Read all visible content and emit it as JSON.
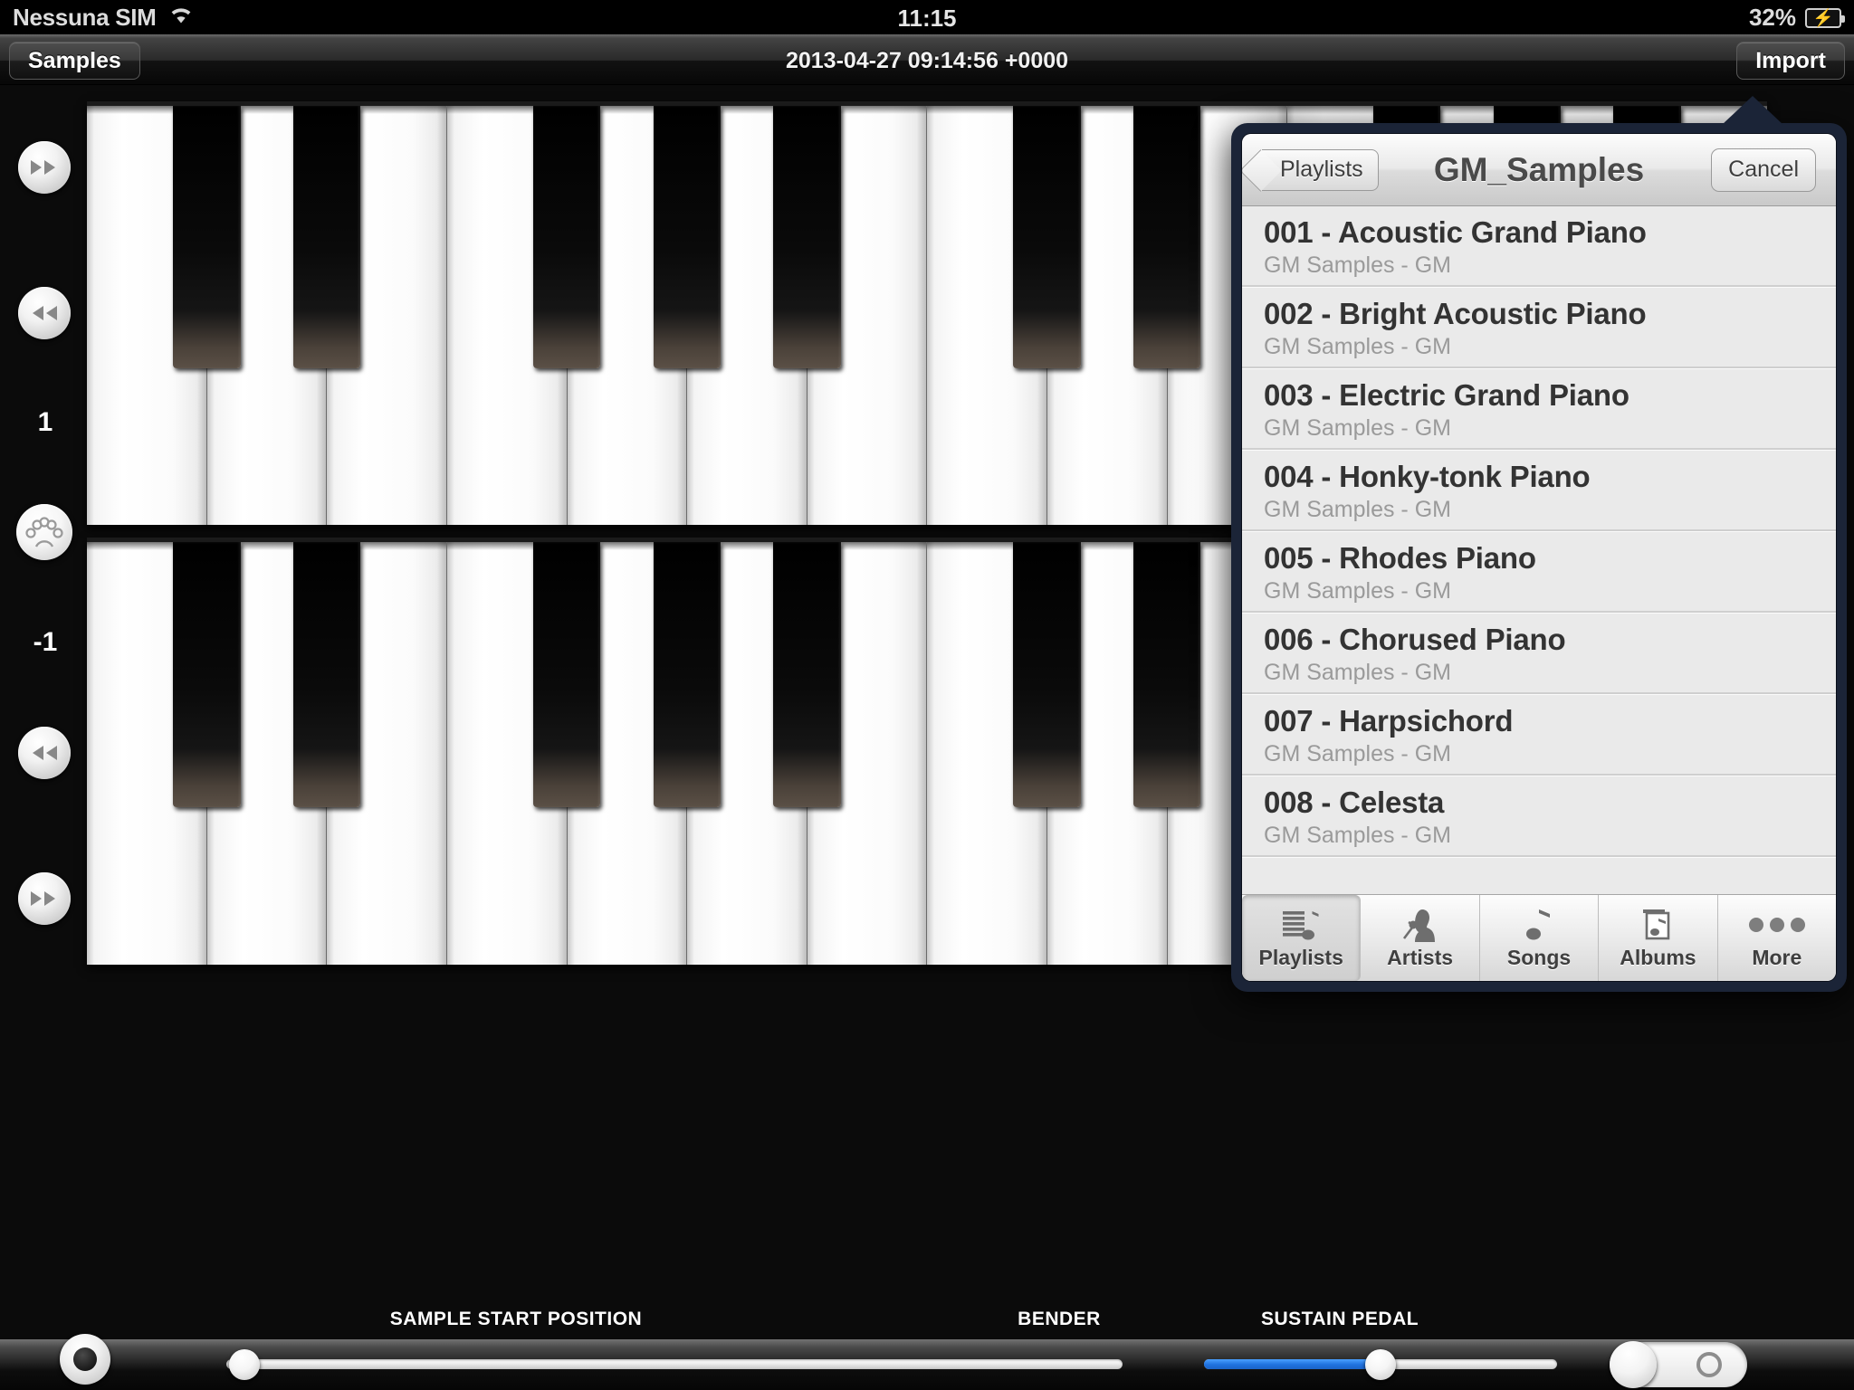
{
  "status_bar": {
    "carrier": "Nessuna SIM",
    "wifi_icon": "wifi-icon",
    "time": "11:15",
    "battery_percent": "32%",
    "battery_icon": "battery-charging-icon"
  },
  "navbar": {
    "back_label": "Samples",
    "title": "2013-04-27 09:14:56 +0000",
    "import_label": "Import"
  },
  "side_controls": {
    "upper_octave_up": "fast-forward-icon",
    "upper_octave_down": "rewind-icon",
    "upper_transpose_value": "1",
    "midi_icon": "midi-din-icon",
    "lower_transpose_value": "-1",
    "lower_octave_down": "rewind-icon",
    "lower_octave_up": "fast-forward-icon",
    "right_upper": "fast-forward-icon",
    "right_lower": "rewind-icon"
  },
  "bottom": {
    "sample_start_label": "SAMPLE START POSITION",
    "bender_label": "BENDER",
    "sustain_label": "SUSTAIN PEDAL",
    "sample_start_value": 2,
    "bender_value": 50,
    "sustain_on": false,
    "accent_color": "#1f72e0"
  },
  "popover": {
    "back_label": "Playlists",
    "title": "GM_Samples",
    "cancel_label": "Cancel",
    "rows": [
      {
        "title": "001 - Acoustic Grand Piano",
        "subtitle": "GM Samples - GM"
      },
      {
        "title": "002 - Bright Acoustic Piano",
        "subtitle": "GM Samples - GM"
      },
      {
        "title": "003 - Electric Grand Piano",
        "subtitle": "GM Samples - GM"
      },
      {
        "title": "004 - Honky-tonk Piano",
        "subtitle": "GM Samples - GM"
      },
      {
        "title": "005 - Rhodes Piano",
        "subtitle": "GM Samples - GM"
      },
      {
        "title": "006 - Chorused Piano",
        "subtitle": "GM Samples - GM"
      },
      {
        "title": "007 - Harpsichord",
        "subtitle": "GM Samples - GM"
      },
      {
        "title": "008 - Celesta",
        "subtitle": "GM Samples - GM"
      }
    ],
    "tabs": [
      {
        "label": "Playlists",
        "icon": "playlist-note-icon",
        "selected": true
      },
      {
        "label": "Artists",
        "icon": "artist-mic-icon",
        "selected": false
      },
      {
        "label": "Songs",
        "icon": "music-note-icon",
        "selected": false
      },
      {
        "label": "Albums",
        "icon": "album-note-icon",
        "selected": false
      },
      {
        "label": "More",
        "icon": "ellipsis-icon",
        "selected": false
      }
    ]
  },
  "keyboards": {
    "upper": {
      "white_keys": 14,
      "black_pattern": [
        0,
        1,
        1,
        0,
        1,
        1,
        1,
        0,
        1,
        1,
        0,
        1,
        1,
        1
      ]
    },
    "lower": {
      "white_keys": 14,
      "black_pattern": [
        0,
        1,
        1,
        0,
        1,
        1,
        1,
        0,
        1,
        1,
        0,
        1,
        1,
        1
      ]
    }
  }
}
